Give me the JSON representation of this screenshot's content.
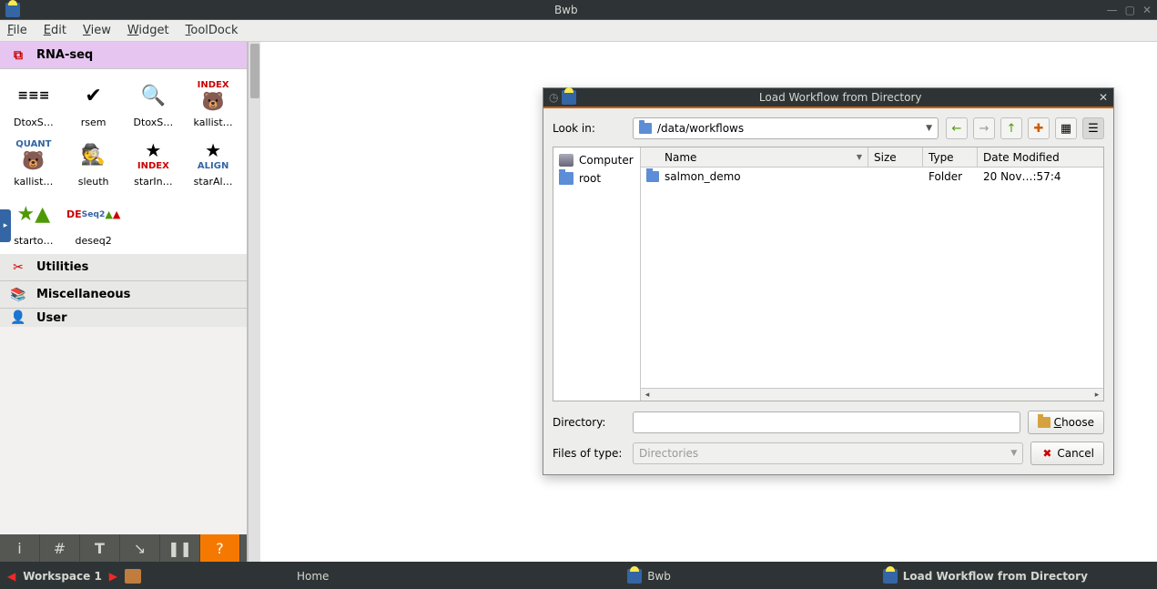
{
  "window": {
    "title": "Bwb"
  },
  "menubar": {
    "file": "File",
    "edit": "Edit",
    "view": "View",
    "widget": "Widget",
    "tooldock": "ToolDock"
  },
  "sidebar": {
    "categories": {
      "rna_seq": {
        "label": "RNA-seq"
      },
      "utilities": {
        "label": "Utilities"
      },
      "misc": {
        "label": "Miscellaneous"
      },
      "user": {
        "label": "User"
      }
    },
    "widgets": [
      {
        "label": "DtoxS…"
      },
      {
        "label": "rsem"
      },
      {
        "label": "DtoxS…"
      },
      {
        "label": "kallist…"
      },
      {
        "label": "kallist…"
      },
      {
        "label": "sleuth"
      },
      {
        "label": "starIn…"
      },
      {
        "label": "starAl…"
      },
      {
        "label": "starto…"
      },
      {
        "label": "deseq2"
      }
    ]
  },
  "dialog": {
    "title": "Load Workflow from Directory",
    "look_in_label": "Look in:",
    "path": "/data/workflows",
    "places": {
      "computer": "Computer",
      "root": "root"
    },
    "columns": {
      "name": "Name",
      "size": "Size",
      "type": "Type",
      "date": "Date Modified"
    },
    "rows": [
      {
        "name": "salmon_demo",
        "size": "",
        "type": "Folder",
        "date": "20 Nov…:57:4"
      }
    ],
    "directory_label": "Directory:",
    "directory_value": "",
    "files_of_type_label": "Files of type:",
    "files_of_type_value": "Directories",
    "choose": "Choose",
    "cancel": "Cancel"
  },
  "taskbar": {
    "workspace": "Workspace 1",
    "tasks": [
      {
        "label": "Home"
      },
      {
        "label": "Bwb"
      },
      {
        "label": "Load Workflow from Directory"
      }
    ]
  }
}
